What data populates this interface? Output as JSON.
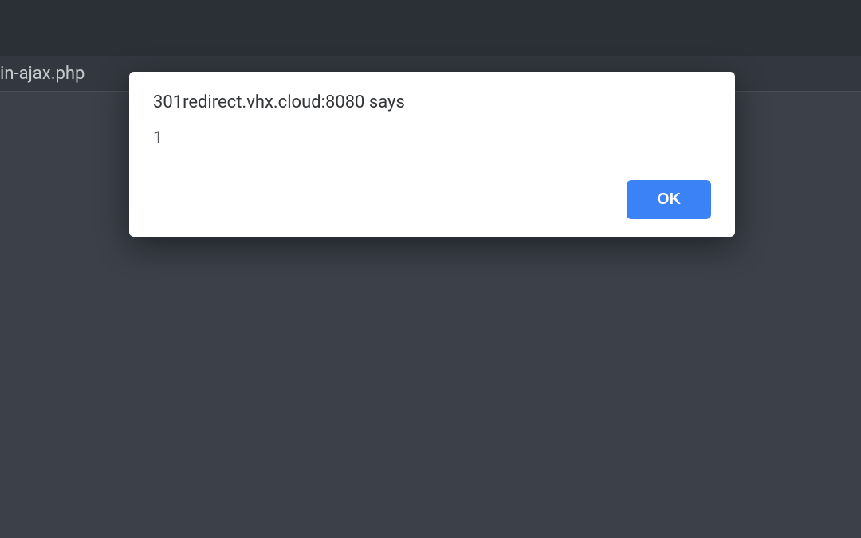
{
  "urlbar": {
    "text": "in-ajax.php"
  },
  "dialog": {
    "title": "301redirect.vhx.cloud:8080 says",
    "message": "1",
    "ok_label": "OK"
  }
}
